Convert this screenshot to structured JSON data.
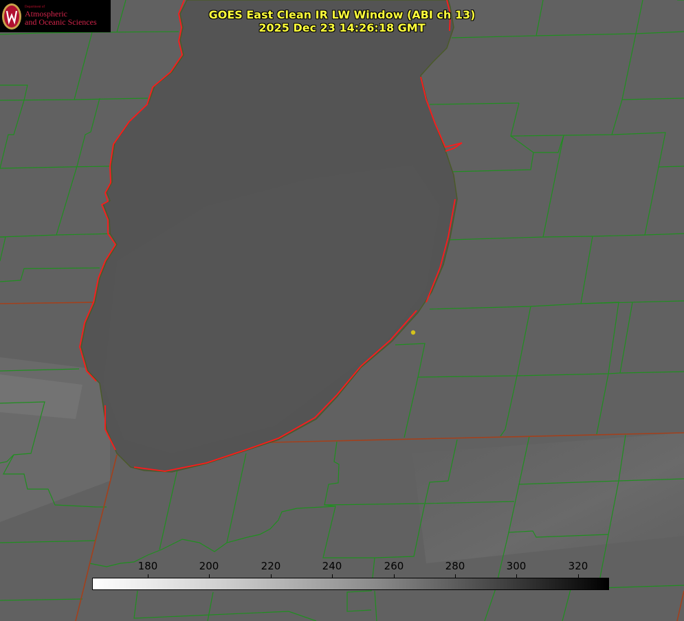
{
  "logo": {
    "department": "Department of",
    "line1": "Atmospheric",
    "line2": "and Oceanic Sciences"
  },
  "title": {
    "line1": "GOES East Clean IR LW Window (ABI ch 13)",
    "line2": "2025 Dec 23 14:26:18 GMT"
  },
  "colorbar": {
    "ticks": [
      "180",
      "200",
      "220",
      "240",
      "260",
      "280",
      "300",
      "320"
    ]
  },
  "colors": {
    "background": "#606060",
    "lake": "#555555",
    "county_lines": "#1f8f1f",
    "state_lines": "#a3401c",
    "coastline": "#ff1a1a",
    "title_text": "#ffff3c",
    "marker": "#d4c21c"
  }
}
